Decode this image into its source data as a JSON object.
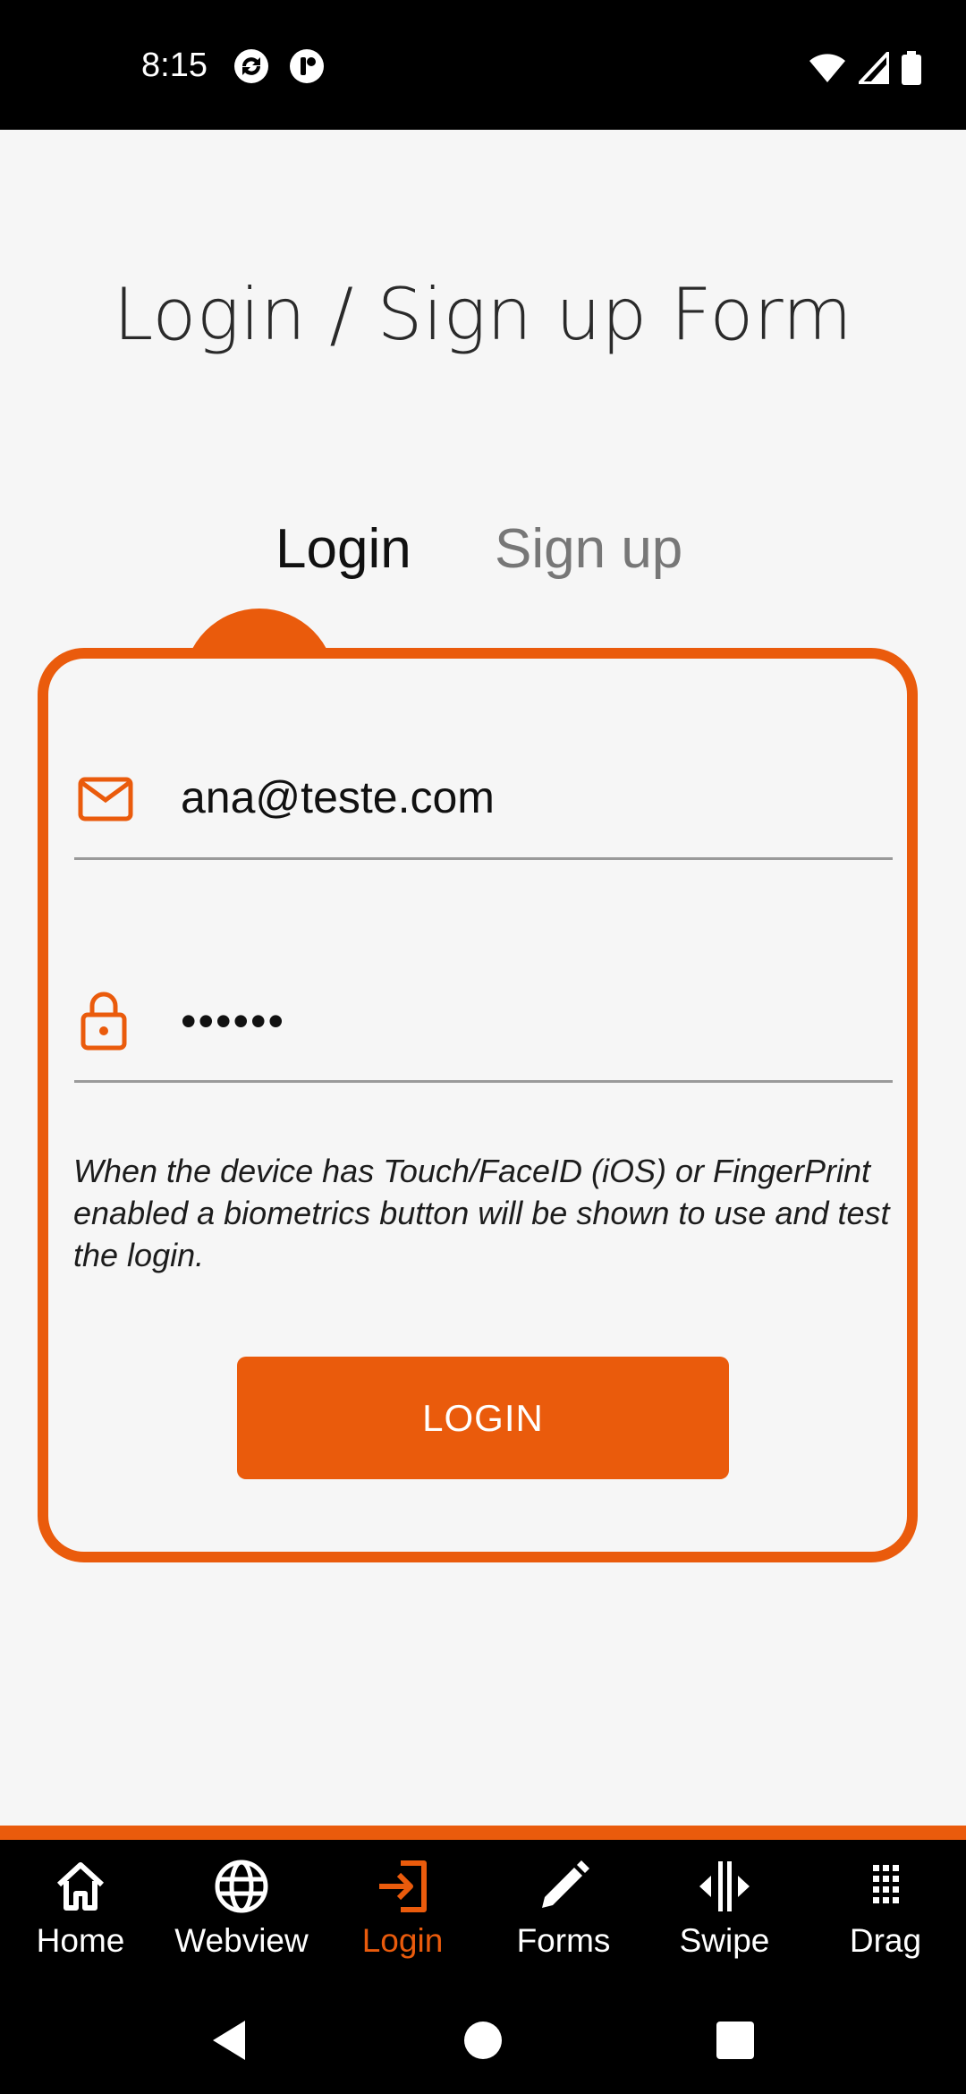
{
  "status_bar": {
    "time": "8:15"
  },
  "header": {
    "title": "Login / Sign up Form"
  },
  "tabs": [
    {
      "label": "Login",
      "active": true
    },
    {
      "label": "Sign up",
      "active": false
    }
  ],
  "form": {
    "email": {
      "value": "ana@teste.com",
      "icon": "mail-icon"
    },
    "password": {
      "value": "••••••",
      "icon": "lock-icon"
    },
    "hint": "When the device has Touch/FaceID (iOS) or FingerPrint enabled a biometrics button will be shown to use and test the login.",
    "submit_label": "LOGIN"
  },
  "bottom_nav": {
    "items": [
      {
        "label": "Home",
        "icon": "home-icon",
        "active": false
      },
      {
        "label": "Webview",
        "icon": "globe-icon",
        "active": false
      },
      {
        "label": "Login",
        "icon": "login-icon",
        "active": true
      },
      {
        "label": "Forms",
        "icon": "pencil-icon",
        "active": false
      },
      {
        "label": "Swipe",
        "icon": "swipe-icon",
        "active": false
      },
      {
        "label": "Drag",
        "icon": "grid-icon",
        "active": false
      }
    ]
  },
  "colors": {
    "accent": "#ea5b0c",
    "background": "#f6f6f6",
    "bar": "#000000"
  }
}
